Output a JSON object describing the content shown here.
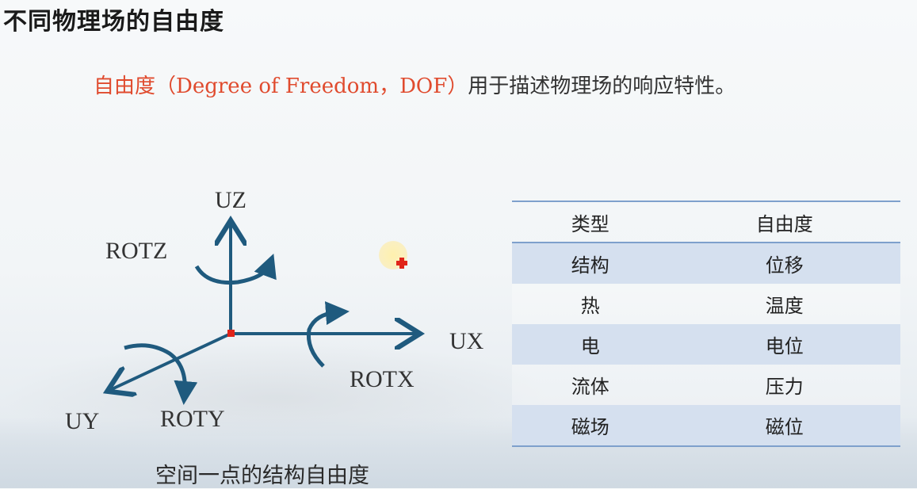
{
  "slide_title": "不同物理场的自由度",
  "intro": {
    "highlight": "自由度（Degree of Freedom，DOF）",
    "rest": "用于描述物理场的响应特性。"
  },
  "diagram": {
    "axes": {
      "uz": "UZ",
      "ux": "UX",
      "uy": "UY"
    },
    "rotations": {
      "rotz": "ROTZ",
      "rotx": "ROTX",
      "roty": "ROTY"
    },
    "caption": "空间一点的结构自由度",
    "colors": {
      "axis": "#1f5a7e",
      "origin": "#e0241a"
    }
  },
  "table": {
    "headers": [
      "类型",
      "自由度"
    ],
    "rows": [
      [
        "结构",
        "位移"
      ],
      [
        "热",
        "温度"
      ],
      [
        "电",
        "电位"
      ],
      [
        "流体",
        "压力"
      ],
      [
        "磁场",
        "磁位"
      ]
    ]
  }
}
